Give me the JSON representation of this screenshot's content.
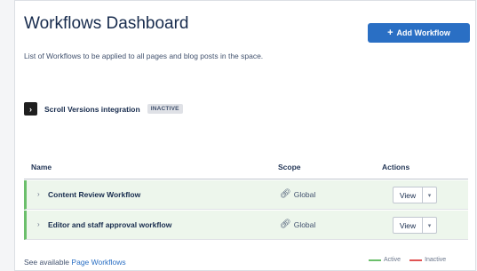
{
  "header": {
    "title": "Workflows Dashboard",
    "subtitle": "List of Workflows to be applied to all pages and blog posts in the space.",
    "add_button_label": "Add Workflow"
  },
  "integration": {
    "icon": "arrow-right-icon",
    "title": "Scroll Versions integration",
    "status": "INACTIVE"
  },
  "table": {
    "headers": {
      "name": "Name",
      "scope": "Scope",
      "actions": "Actions"
    },
    "rows": [
      {
        "name": "Content Review Workflow",
        "scope": "Global",
        "view_label": "View"
      },
      {
        "name": "Editor and staff approval workflow",
        "scope": "Global",
        "view_label": "View"
      }
    ]
  },
  "footer": {
    "prefix": "See available",
    "link": "Page Workflows"
  },
  "legend": {
    "active_label": "Active",
    "inactive_label": "Inactive",
    "active_color": "#6bbf6b",
    "inactive_color": "#e05454"
  }
}
